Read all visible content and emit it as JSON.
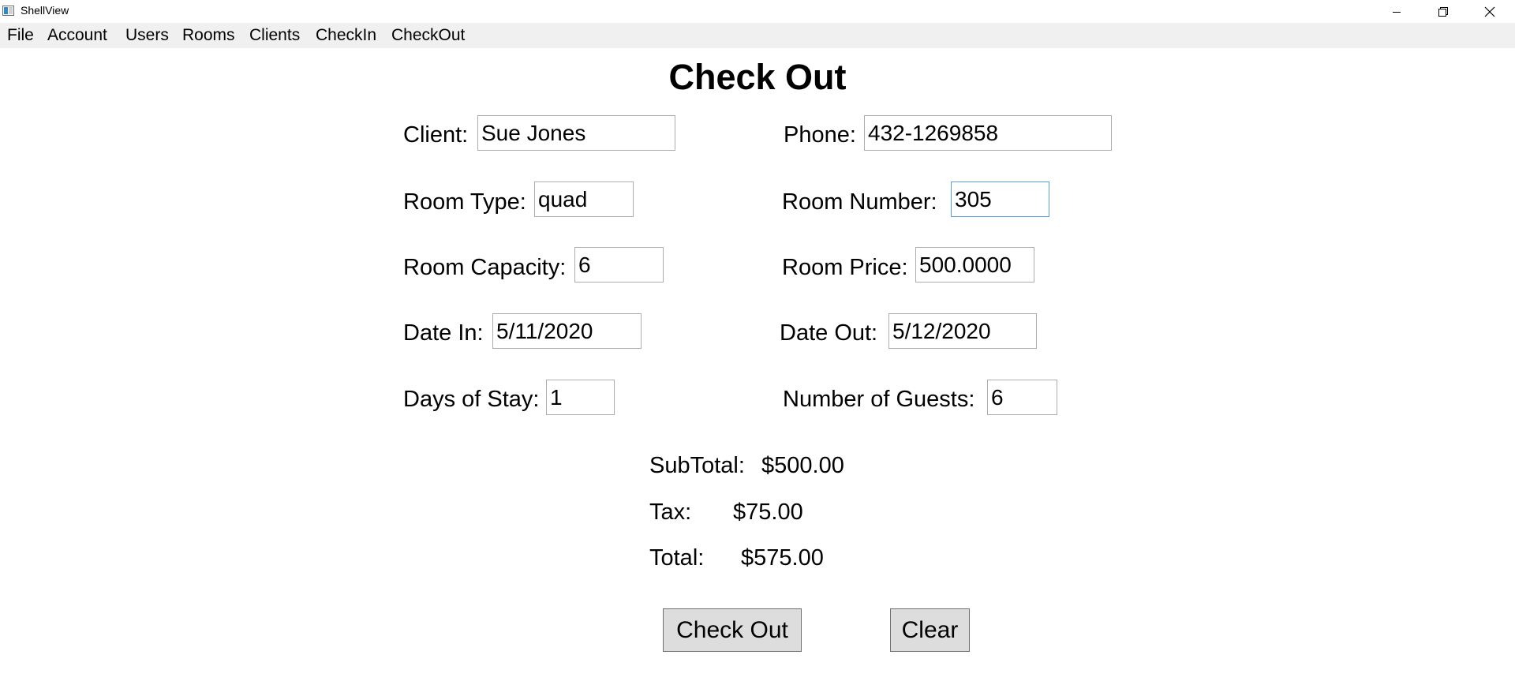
{
  "window": {
    "title": "ShellView"
  },
  "menu": [
    {
      "label": "File"
    },
    {
      "label": "Account"
    },
    {
      "label": "Users"
    },
    {
      "label": "Rooms"
    },
    {
      "label": "Clients"
    },
    {
      "label": "CheckIn"
    },
    {
      "label": "CheckOut"
    }
  ],
  "page": {
    "title": "Check Out"
  },
  "form": {
    "client": {
      "label": "Client:",
      "value": "Sue Jones"
    },
    "phone": {
      "label": "Phone:",
      "value": "432-1269858"
    },
    "room_type": {
      "label": "Room Type:",
      "value": "quad"
    },
    "room_number": {
      "label": "Room Number:",
      "value": "305"
    },
    "room_capacity": {
      "label": "Room Capacity:",
      "value": "6"
    },
    "room_price": {
      "label": "Room Price:",
      "value": "500.0000"
    },
    "date_in": {
      "label": "Date In:",
      "value": "5/11/2020"
    },
    "date_out": {
      "label": "Date Out:",
      "value": "5/12/2020"
    },
    "days_of_stay": {
      "label": "Days of Stay:",
      "value": "1"
    },
    "number_of_guests": {
      "label": "Number of Guests:",
      "value": "6"
    }
  },
  "summary": {
    "subtotal": {
      "label": "SubTotal:",
      "value": "$500.00"
    },
    "tax": {
      "label": "Tax:",
      "value": "$75.00"
    },
    "total": {
      "label": "Total:",
      "value": "$575.00"
    }
  },
  "buttons": {
    "checkout": "Check Out",
    "clear": "Clear"
  },
  "icons": {
    "app": "app-icon",
    "minimize": "minimize-icon",
    "maximize": "restore-icon",
    "close": "close-icon"
  },
  "colors": {
    "menubar": "#f0f0f0",
    "focus_border": "#569de5",
    "button_bg": "#dddddd"
  }
}
